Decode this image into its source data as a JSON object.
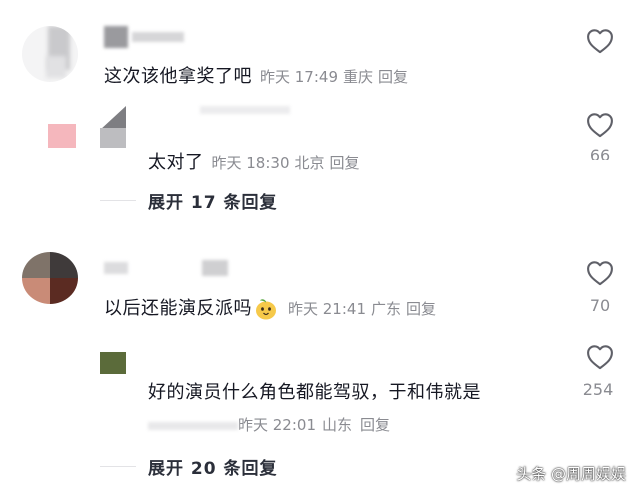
{
  "comments": [
    {
      "text": "这次该他拿奖了吧",
      "time": "昨天 17:49",
      "location": "重庆",
      "reply_label": "回复",
      "likes": ""
    },
    {
      "text": "太对了",
      "time": "昨天 18:30",
      "location": "北京",
      "reply_label": "回复",
      "expand_label": "展开 17 条回复",
      "likes": "66"
    },
    {
      "text": "以后还能演反派吗",
      "emoji": "mango-face-emoji",
      "time": "昨天 21:41",
      "location": "广东",
      "reply_label": "回复",
      "likes": "70"
    },
    {
      "text": "好的演员什么角色都能驾驭，于和伟就是",
      "time": "昨天 22:01",
      "location": "山东",
      "reply_label": "回复",
      "expand_label": "展开 20 条回复",
      "likes": "254"
    }
  ],
  "watermark": "头条 @周周娱娱",
  "colors": {
    "text": "#161823",
    "meta": "#8a8b91",
    "icon": "#5f6068"
  },
  "icons": [
    "heart-outline-icon",
    "mango-face-emoji"
  ]
}
